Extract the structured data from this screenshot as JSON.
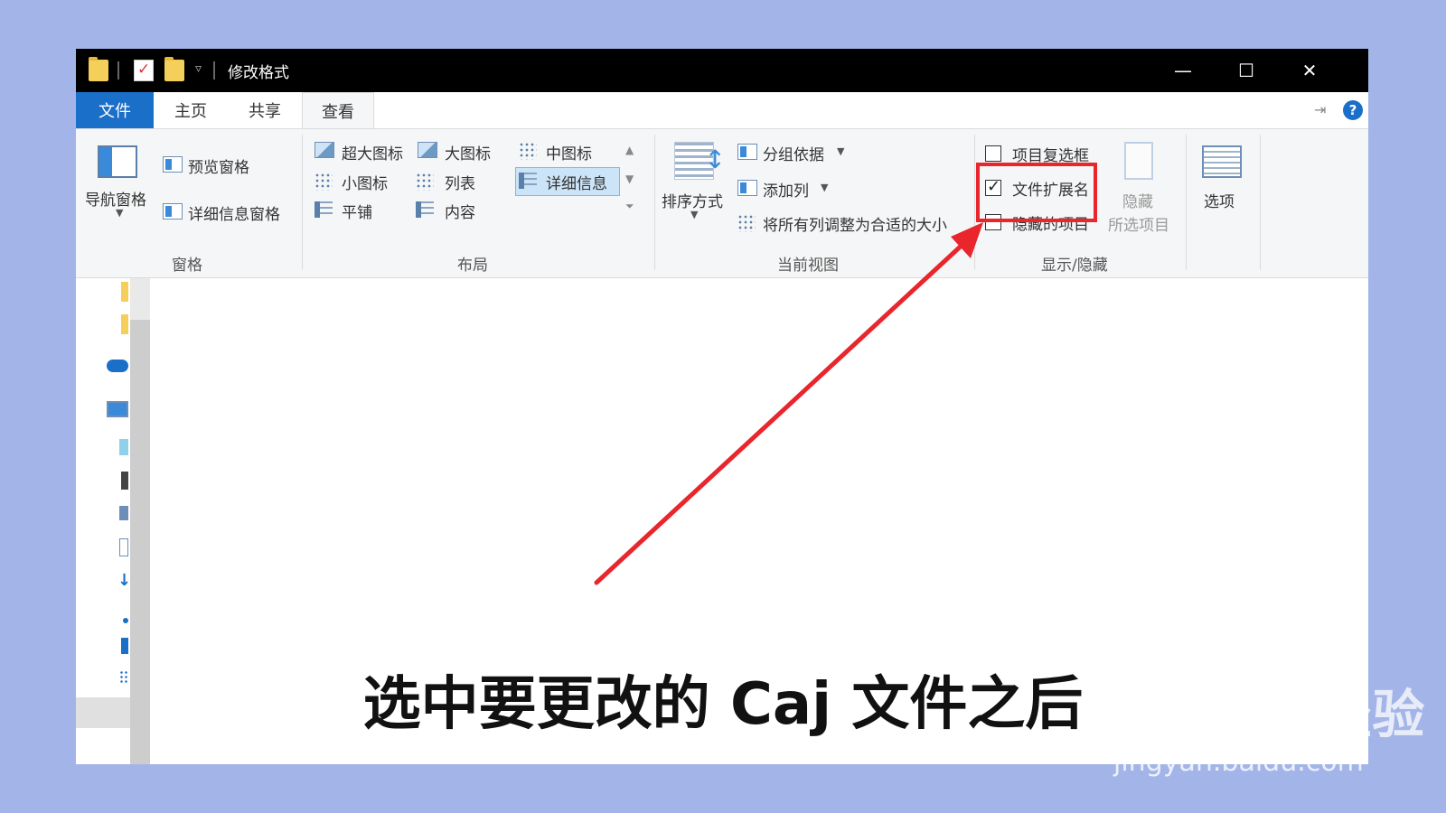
{
  "window": {
    "title": "修改格式",
    "controls": {
      "minimize": "—",
      "maximize": "☐",
      "close": "✕"
    }
  },
  "tabs": {
    "file": "文件",
    "home": "主页",
    "share": "共享",
    "view": "查看"
  },
  "ribbon": {
    "panes": {
      "nav_pane": "导航窗格",
      "preview_pane": "预览窗格",
      "details_pane": "详细信息窗格",
      "group_label": "窗格"
    },
    "layout": {
      "extra_large_icons": "超大图标",
      "large_icons": "大图标",
      "medium_icons": "中图标",
      "small_icons": "小图标",
      "list": "列表",
      "details": "详细信息",
      "tiles": "平铺",
      "content": "内容",
      "group_label": "布局",
      "selected": "详细信息"
    },
    "current_view": {
      "sort_by": "排序方式",
      "group_by": "分组依据",
      "add_columns": "添加列",
      "size_all_columns": "将所有列调整为合适的大小",
      "group_label": "当前视图"
    },
    "show_hide": {
      "item_checkboxes": "项目复选框",
      "item_checkboxes_checked": false,
      "file_extensions": "文件扩展名",
      "file_extensions_checked": true,
      "hidden_items": "隐藏的项目",
      "hidden_items_checked": false,
      "hide_selected_line1": "隐藏",
      "hide_selected_line2": "所选项目",
      "group_label": "显示/隐藏"
    },
    "options": "选项"
  },
  "overlay": {
    "subtitle": "选中要更改的 Caj 文件之后",
    "watermark_logo": "Bai du 经验",
    "watermark_url": "jingyan.baidu.com",
    "highlight_color": "#e8262c",
    "arrow_color": "#e8262c"
  }
}
